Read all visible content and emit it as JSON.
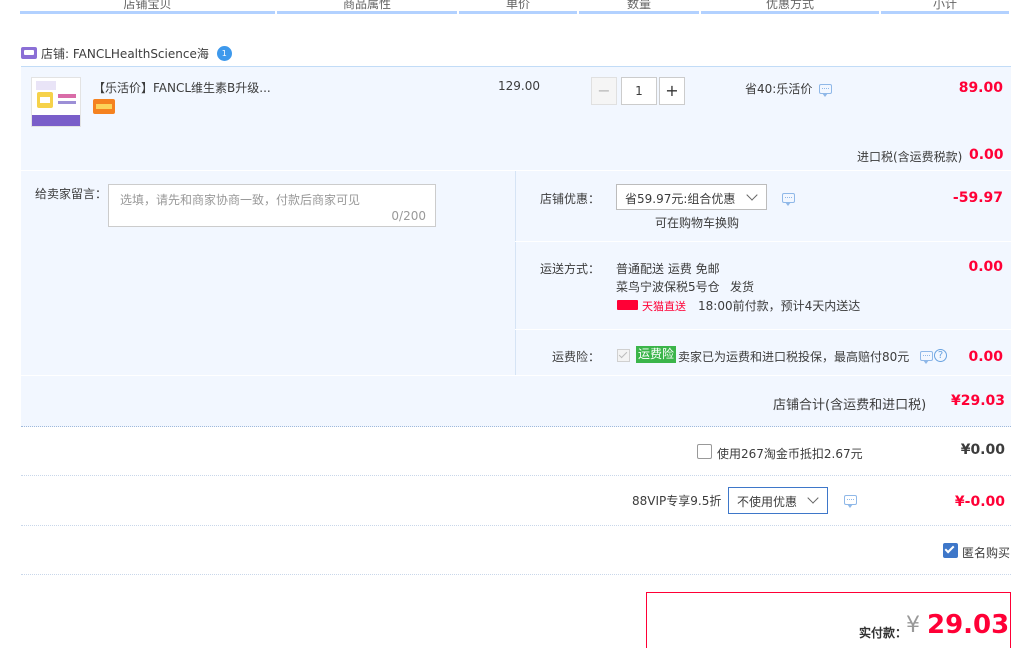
{
  "header": {
    "columns": [
      "店铺宝贝",
      "商品属性",
      "单价",
      "数量",
      "优惠方式",
      "小计"
    ]
  },
  "shop": {
    "label": "店铺: FANCLHealthScience海",
    "badge": "1"
  },
  "item": {
    "title": "【乐活价】FANCL维生素B升级...",
    "price": "129.00",
    "quantity": "1",
    "discount_label": "省40:乐活价",
    "subtotal": "89.00",
    "import_tax_label": "进口税(含运费税款)",
    "import_tax_value": "0.00"
  },
  "message": {
    "label": "给卖家留言：",
    "placeholder": "选填，请先和商家协商一致，付款后商家可见",
    "counter": "0/200"
  },
  "shop_discount": {
    "label": "店铺优惠：",
    "selected": "省59.97元:组合优惠",
    "note": "可在购物车换购",
    "value": "-59.97"
  },
  "shipping": {
    "label": "运送方式：",
    "method": "普通配送 运费 免邮",
    "warehouse": "菜鸟宁波保税5号仓",
    "ship_action": "发货",
    "badge": "天猫直送",
    "eta": "18:00前付款，预计4天内送达",
    "value": "0.00"
  },
  "insurance": {
    "label": "运费险：",
    "tag": "运费险",
    "desc": "卖家已为运费和进口税投保，最高赔付80元",
    "value": "0.00"
  },
  "shop_total": {
    "label": "店铺合计(含运费和进口税)",
    "value": "¥29.03"
  },
  "coins": {
    "label": "使用267淘金币抵扣2.67元",
    "value": "¥0.00"
  },
  "vip": {
    "label": "88VIP专享9.5折",
    "selected": "不使用优惠",
    "value": "¥-0.00"
  },
  "anonymous": {
    "label": "匿名购买"
  },
  "payment": {
    "label": "实付款：",
    "currency": "¥",
    "amount": "29.03"
  },
  "colors": {
    "accent_red": "#ff0036",
    "light_blue_bg": "#f2f7ff",
    "header_line": "#b2d1ff",
    "tmall_red": "#ff0036",
    "insurance_green": "#3bb54a"
  }
}
